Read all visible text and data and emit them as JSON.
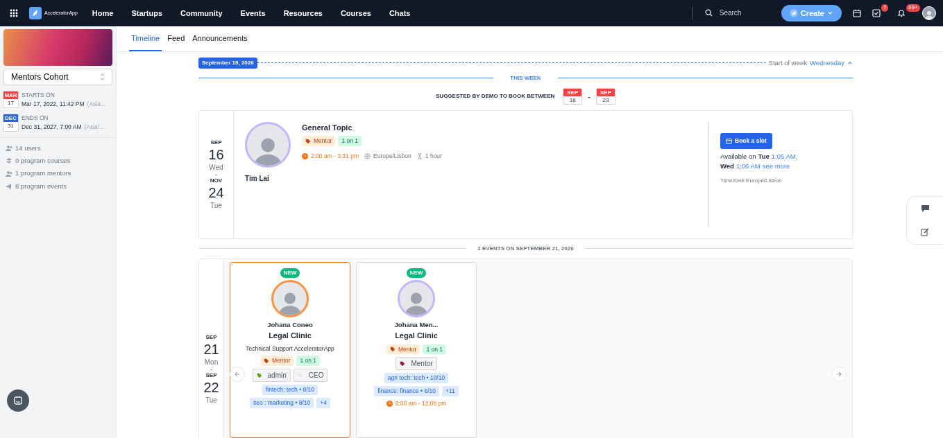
{
  "navbar": {
    "brand": "AcceleratorApp",
    "links": [
      {
        "label": "Home",
        "selected": false
      },
      {
        "label": "Startups",
        "selected": false
      },
      {
        "label": "Community",
        "selected": false
      },
      {
        "label": "Events",
        "selected": false
      },
      {
        "label": "Resources",
        "selected": false
      },
      {
        "label": "Courses",
        "selected": false
      },
      {
        "label": "Chats",
        "selected": false
      }
    ],
    "search": {
      "placeholder": "Search"
    },
    "create_button": "Create",
    "tasks_badge": "7",
    "notifications_badge": "99+"
  },
  "sidebar": {
    "cohort": "Mentors Cohort",
    "dates": [
      {
        "label": "STARTS ON",
        "month": "MAR",
        "day": "17",
        "value": "Mar 17, 2022, 11:42 PM",
        "timezone": "(Asia...",
        "color": "#ef4444"
      },
      {
        "label": "ENDS ON",
        "month": "DEC",
        "day": "31",
        "value": "Dec 31, 2027, 7:00 AM",
        "timezone": "(Asia/...",
        "color": "#2563eb"
      }
    ],
    "stats": [
      {
        "kind": "users",
        "text": "14 users"
      },
      {
        "kind": "courses",
        "text": "0 program courses"
      },
      {
        "kind": "users",
        "text": "1 program mentors"
      },
      {
        "kind": "events",
        "text": "8 program events"
      }
    ]
  },
  "tabs": [
    {
      "label": "Timeline",
      "selected": true
    },
    {
      "label": "Feed",
      "selected": false
    },
    {
      "label": "Announcements",
      "selected": false
    }
  ],
  "timeline": {
    "date_marker": "September 19, 2026",
    "week_start_label": "Start of week",
    "week_start_value": "Wednesday",
    "week_heading": "THIS WEEK",
    "suggestion": {
      "text": "SUGGESTED BY DEMO TO BOOK BETWEEN",
      "from": {
        "month": "SEP",
        "day": "16"
      },
      "separator": "-",
      "to": {
        "month": "SEP",
        "day": "23"
      }
    },
    "first_event": {
      "dates": {
        "start_month": "SEP",
        "start_day": "16",
        "start_weekday": "Wed",
        "separator": "-",
        "end_month": "NOV",
        "end_day": "24",
        "end_weekday": "Tue"
      },
      "host": "Tim Lai",
      "title": "General Topic",
      "tags": [
        {
          "kind": "role",
          "label": "Mentor"
        },
        {
          "kind": "format",
          "label": "1 on 1"
        }
      ],
      "time": "2:00 am - 3:31 pm",
      "timezone": "Europe/Lisbon",
      "duration": "1 hour",
      "book_button": "Book a slot",
      "availability": [
        {
          "kind": "plain",
          "text": "Available on"
        },
        {
          "kind": "bold",
          "text": "Tue"
        },
        {
          "kind": "link",
          "text": "1:05 AM,"
        },
        {
          "kind": "bold",
          "text": "Wed"
        },
        {
          "kind": "link",
          "text": "1:06 AM"
        },
        {
          "kind": "link",
          "text": "see more"
        }
      ],
      "timezone_note": "Timezone:Europe/Lisbon"
    },
    "day_divider": "2 EVENTS ON SEPTEMBER 21, 2026",
    "second_group": {
      "dates": {
        "start_month": "SEP",
        "start_day": "21",
        "start_weekday": "Mon",
        "separator": "-",
        "end_month": "SEP",
        "end_day": "22",
        "end_weekday": "Tue"
      },
      "cards": [
        {
          "badge": "NEW",
          "highlighted": true,
          "color": "#fb923c",
          "name": "Johana Coneo",
          "title": "Legal Clinic",
          "subtitle": "Technical Support AcceleratorApp",
          "tags": [
            {
              "kind": "role",
              "label": "Mentor"
            },
            {
              "kind": "format",
              "label": "1 on 1"
            }
          ],
          "roles": [
            {
              "label": "admin",
              "color": "#65a30d"
            },
            {
              "label": "CEO",
              "color": "#e5e7eb"
            }
          ],
          "skills": [
            [
              "fintech: tech • 8/10"
            ],
            [
              "seo : marketing • 8/10",
              "+4"
            ]
          ]
        },
        {
          "badge": "NEW",
          "highlighted": false,
          "color": "#c4b5fd",
          "name": "Johana Men...",
          "title": "Legal Clinic",
          "tags": [
            {
              "kind": "role",
              "label": "Mentor"
            },
            {
              "kind": "format",
              "label": "1 on 1"
            }
          ],
          "roles": [
            {
              "label": "Mentor",
              "color": "#9f1239"
            }
          ],
          "skills": [
            [
              "agri tech: tech • 10/10"
            ],
            [
              "finance: finance • 6/10",
              "+11"
            ]
          ],
          "time": "8:00 am - 12:06 pm"
        }
      ]
    }
  }
}
